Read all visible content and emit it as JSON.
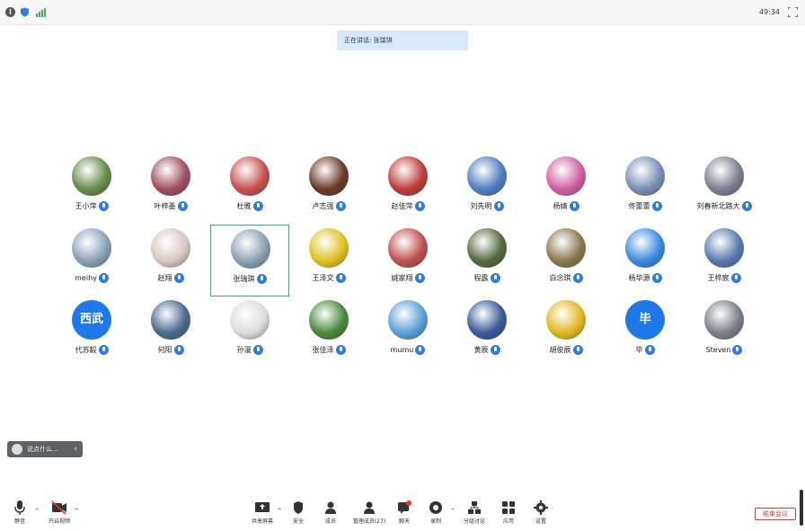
{
  "window": {
    "title": "",
    "timer": "49:34"
  },
  "notice": {
    "text": "正在讲话: 张瑞琪"
  },
  "participants": [
    {
      "name": "王小萍",
      "avatar": "photo",
      "color": "#6a8b4a"
    },
    {
      "name": "叶梓墨",
      "avatar": "photo",
      "color": "#a05060"
    },
    {
      "name": "杜雅",
      "avatar": "photo",
      "color": "#c85050"
    },
    {
      "name": "卢志强",
      "avatar": "photo",
      "color": "#6b3a2a"
    },
    {
      "name": "赵佳萍",
      "avatar": "photo",
      "color": "#c03c3c"
    },
    {
      "name": "刘先明",
      "avatar": "photo",
      "color": "#4f7ec2"
    },
    {
      "name": "杨婧",
      "avatar": "photo",
      "color": "#d060a0"
    },
    {
      "name": "佟蕾蕾",
      "avatar": "photo",
      "color": "#7a8fb8"
    },
    {
      "name": "刘春新北路大",
      "avatar": "photo",
      "color": "#7a8090"
    },
    {
      "name": "meihy",
      "avatar": "photo",
      "color": "#8aa0b8"
    },
    {
      "name": "赵翔",
      "avatar": "photo",
      "color": "#d8c8c0"
    },
    {
      "name": "张瑞琪",
      "avatar": "photo",
      "color": "#8aa0b0",
      "active": true
    },
    {
      "name": "王泽文",
      "avatar": "photo",
      "color": "#e0c020"
    },
    {
      "name": "姚家翔",
      "avatar": "photo",
      "color": "#c05050"
    },
    {
      "name": "程露",
      "avatar": "photo",
      "color": "#556a40"
    },
    {
      "name": "白念琪",
      "avatar": "photo",
      "color": "#8a7a50"
    },
    {
      "name": "杨华源",
      "avatar": "photo",
      "color": "#3a8ae0"
    },
    {
      "name": "王梓宸",
      "avatar": "photo",
      "color": "#5a7ab0"
    },
    {
      "name": "代苏毅",
      "avatar": "text",
      "text": "西武",
      "color": "#1f78e8"
    },
    {
      "name": "何阳",
      "avatar": "photo",
      "color": "#4a6a90"
    },
    {
      "name": "孙漫",
      "avatar": "photo",
      "color": "#dcdcdc"
    },
    {
      "name": "张佳泽",
      "avatar": "photo",
      "color": "#4a8a3a"
    },
    {
      "name": "mumu",
      "avatar": "photo",
      "color": "#5aa0d8"
    },
    {
      "name": "黄辰",
      "avatar": "photo",
      "color": "#3a5a9a"
    },
    {
      "name": "胡俊辰",
      "avatar": "photo",
      "color": "#e0b820"
    },
    {
      "name": "毕",
      "avatar": "text",
      "text": "毕",
      "color": "#1f78e8"
    },
    {
      "name": "Steven",
      "avatar": "photo",
      "color": "#7a8088"
    }
  ],
  "reaction": {
    "text": "说点什么..."
  },
  "toolbar": {
    "mute": "静音",
    "video": "开启视频",
    "share": "共享屏幕",
    "security": "安全",
    "members": "成员",
    "manage": "管理成员(27)",
    "chat": "聊天",
    "record": "录制",
    "breakout": "分组讨论",
    "apps": "应用",
    "settings": "设置",
    "leave": "结束会议"
  }
}
